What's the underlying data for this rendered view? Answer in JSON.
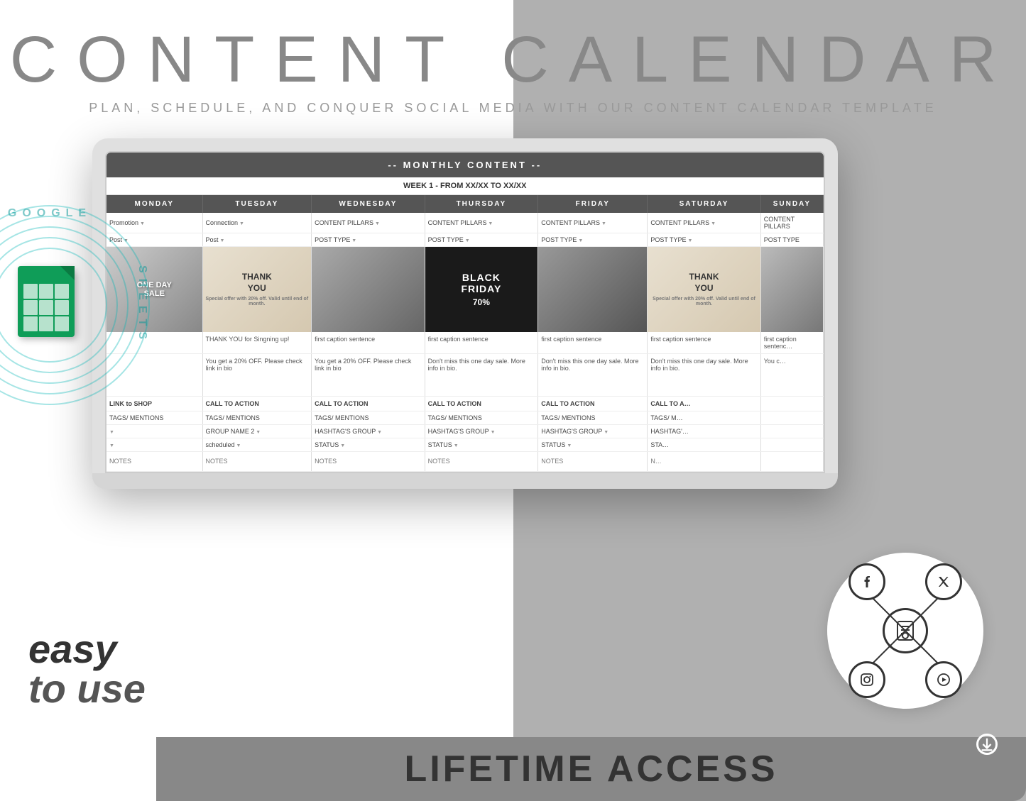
{
  "header": {
    "title": "CONTENT CALENDAR",
    "subtitle": "PLAN, SCHEDULE, AND CONQUER SOCIAL MEDIA WITH OUR CONTENT CALENDAR TEMPLATE"
  },
  "spreadsheet": {
    "sheet_title": "-- MONTHLY CONTENT --",
    "week_label": "WEEK 1 - FROM XX/XX TO XX/XX",
    "days": [
      "MONDAY",
      "TUESDAY",
      "WEDNESDAY",
      "THURSDAY",
      "FRIDAY",
      "SATURDAY",
      "SUNDAY"
    ],
    "row_type1": [
      "Promotion",
      "Connection",
      "CONTENT PILLARS",
      "CONTENT PILLARS",
      "CONTENT PILLARS",
      "CONTENT PILLARS",
      "CONTENT PILLARS"
    ],
    "row_type2": [
      "Post",
      "Post",
      "POST TYPE",
      "POST TYPE",
      "POST TYPE",
      "POST TYPE",
      "POST TYPE"
    ],
    "row_caption": [
      "",
      "THANK YOU for Singning up!",
      "first caption sentence",
      "first caption sentence",
      "first caption sentence",
      "first caption sentence",
      "first caption sentenc…"
    ],
    "row_body": [
      "",
      "You get a 20% OFF. Please check link in bio",
      "You get a 20% OFF. Please check link in bio",
      "Don't miss this one day sale. More info in bio.",
      "Don't miss this one day sale. More info in bio.",
      "Don't miss this one day sale. More info in bio.",
      "You c…"
    ],
    "row_cta": [
      "LINK to SHOP",
      "CALL TO ACTION",
      "CALL TO ACTION",
      "CALL TO ACTION",
      "CALL TO ACTION",
      "CALL TO A…",
      ""
    ],
    "row_tags": [
      "TAGS/ MENTIONS",
      "TAGS/ MENTIONS",
      "TAGS/ MENTIONS",
      "TAGS/ MENTIONS",
      "TAGS/ MENTIONS",
      "TAGS/ M…",
      ""
    ],
    "row_hashtag": [
      "",
      "GROUP NAME 2",
      "HASHTAG'S GROUP",
      "HASHTAG'S GROUP",
      "HASHTAG'S GROUP",
      "HASHTAG'…",
      ""
    ],
    "row_status": [
      "",
      "scheduled",
      "STATUS",
      "STATUS",
      "STATUS",
      "STA…",
      ""
    ],
    "row_notes": [
      "NOTES",
      "NOTES",
      "NOTES",
      "NOTES",
      "NOTES",
      "N…",
      ""
    ],
    "images": {
      "monday": {
        "type": "sale",
        "text": "ONE DAY SALE"
      },
      "tuesday": {
        "type": "thankyou",
        "text": "THANK YOU"
      },
      "wednesday": {
        "type": "person",
        "text": ""
      },
      "thursday": {
        "type": "blackfriday",
        "text": "BLACK FRIDAY 70%"
      },
      "friday": {
        "type": "person2",
        "text": ""
      },
      "saturday": {
        "type": "thankyou2",
        "text": "THANK YOU"
      },
      "sunday": {
        "type": "person3",
        "text": ""
      }
    }
  },
  "google_sheets": {
    "label": "GOOGLE SHEETS"
  },
  "easy_to_use": {
    "line1": "easy",
    "line2": "to use"
  },
  "lifetime": {
    "text": "LIFETIME ACCESS"
  },
  "social": {
    "platforms": [
      "f",
      "𝕏",
      "▶",
      "📷"
    ],
    "center": "📱"
  },
  "download": {
    "icon": "↓"
  }
}
